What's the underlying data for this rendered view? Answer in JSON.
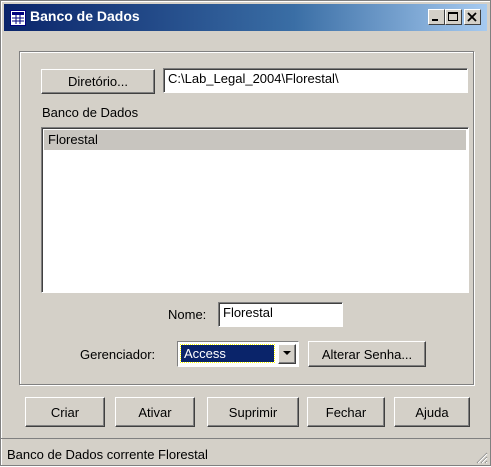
{
  "window": {
    "title": "Banco de Dados",
    "controls": [
      "minimize",
      "maximize",
      "close"
    ]
  },
  "directory": {
    "button_label": "Diretório...",
    "path_value": "C:\\Lab_Legal_2004\\Florestal\\"
  },
  "database_list": {
    "label": "Banco de Dados",
    "items": [
      "Florestal"
    ],
    "selected": "Florestal"
  },
  "name_field": {
    "label": "Nome:",
    "value": "Florestal"
  },
  "manager": {
    "label": "Gerenciador:",
    "selected": "Access",
    "change_password_label": "Alterar Senha..."
  },
  "actions": {
    "create": "Criar",
    "activate": "Ativar",
    "delete": "Suprimir",
    "close": "Fechar",
    "help": "Ajuda"
  },
  "status": {
    "text": "Banco de Dados corrente Florestal"
  },
  "colors": {
    "title_active": "#0a246a",
    "face": "#d4d0c8",
    "selection": "#0a246a"
  }
}
